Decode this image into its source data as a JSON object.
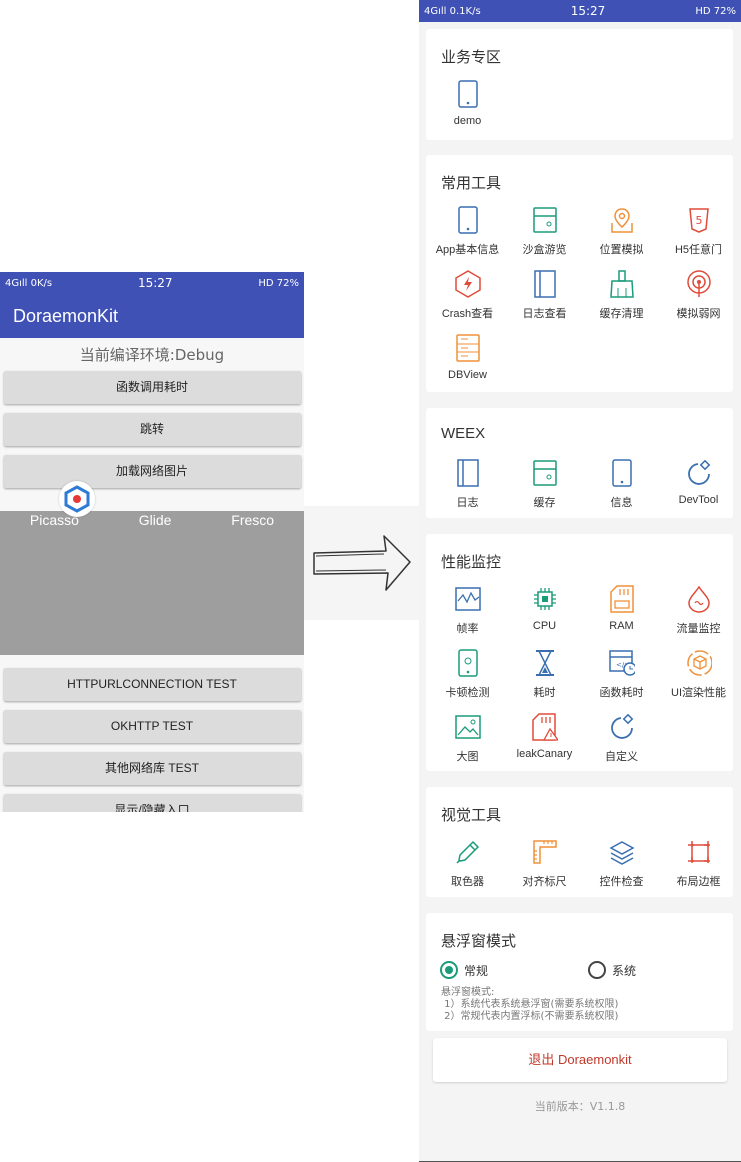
{
  "left_phone": {
    "status": {
      "network": "4Gıll 0K/s",
      "time": "15:27",
      "right": "HD 72%"
    },
    "app_title": "DoraemonKit",
    "env_label": "当前编译环境:Debug",
    "buttons": [
      "函数调用耗时",
      "跳转",
      "加载网络图片"
    ],
    "tabs": [
      "Picasso",
      "Glide",
      "Fresco"
    ],
    "buttons2": [
      "HTTPURLCONNECTION TEST",
      "OKHTTP TEST",
      "其他网络库 TEST",
      "显示/隐藏入口"
    ]
  },
  "right_phone": {
    "status": {
      "network": "4Gıll 0.1K/s",
      "time": "15:27",
      "right": "HD 72%"
    },
    "sections": {
      "biz": {
        "title": "业务专区",
        "items": [
          "demo"
        ]
      },
      "common": {
        "title": "常用工具",
        "items": [
          "App基本信息",
          "沙盒游览",
          "位置模拟",
          "H5任意门",
          "Crash查看",
          "日志查看",
          "缓存清理",
          "模拟弱网",
          "DBView"
        ]
      },
      "weex": {
        "title": "WEEX",
        "items": [
          "日志",
          "缓存",
          "信息",
          "DevTool"
        ]
      },
      "perf": {
        "title": "性能监控",
        "items": [
          "帧率",
          "CPU",
          "RAM",
          "流量监控",
          "卡顿检测",
          "耗时",
          "函数耗时",
          "UI渲染性能",
          "大图",
          "leakCanary",
          "自定义"
        ]
      },
      "visual": {
        "title": "视觉工具",
        "items": [
          "取色器",
          "对齐标尺",
          "控件检查",
          "布局边框"
        ]
      },
      "float": {
        "title": "悬浮窗模式",
        "option_normal": "常规",
        "option_system": "系统",
        "desc": "悬浮窗模式:\n 1）系统代表系统悬浮窗(需要系统权限)\n 2）常规代表内置浮标(不需要系统权限)"
      }
    },
    "exit_label": "退出 Doraemonkit",
    "version": "当前版本：V1.1.8"
  },
  "colors": {
    "primary": "#3f51b5",
    "blue_icon": "#3a6fb0",
    "green_icon": "#1a9c7a",
    "orange_icon": "#f0913a",
    "red_icon": "#e04b3a",
    "exit_text": "#c0392b"
  }
}
